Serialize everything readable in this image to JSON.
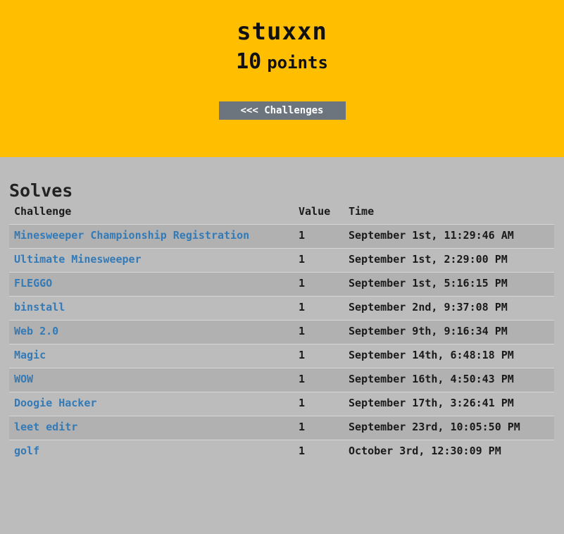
{
  "user": {
    "name": "stuxxn",
    "points_value": "10",
    "points_label": "points",
    "back_button": "<<< Challenges"
  },
  "solves": {
    "title": "Solves",
    "columns": [
      "Challenge",
      "Value",
      "Time"
    ],
    "rows": [
      {
        "challenge": "Minesweeper Championship Registration",
        "value": "1",
        "time": "September 1st, 11:29:46 AM"
      },
      {
        "challenge": "Ultimate Minesweeper",
        "value": "1",
        "time": "September 1st, 2:29:00 PM"
      },
      {
        "challenge": "FLEGGO",
        "value": "1",
        "time": "September 1st, 5:16:15 PM"
      },
      {
        "challenge": "binstall",
        "value": "1",
        "time": "September 2nd, 9:37:08 PM"
      },
      {
        "challenge": "Web 2.0",
        "value": "1",
        "time": "September 9th, 9:16:34 PM"
      },
      {
        "challenge": "Magic",
        "value": "1",
        "time": "September 14th, 6:48:18 PM"
      },
      {
        "challenge": "WOW",
        "value": "1",
        "time": "September 16th, 4:50:43 PM"
      },
      {
        "challenge": "Doogie Hacker",
        "value": "1",
        "time": "September 17th, 3:26:41 PM"
      },
      {
        "challenge": "leet editr",
        "value": "1",
        "time": "September 23rd, 10:05:50 PM"
      },
      {
        "challenge": "golf",
        "value": "1",
        "time": "October 3rd, 12:30:09 PM"
      }
    ]
  },
  "colors": {
    "hero_bg": "#ffbf00",
    "page_bg": "#bcbcbc",
    "link": "#337ab7",
    "button_bg": "#6c757d"
  }
}
